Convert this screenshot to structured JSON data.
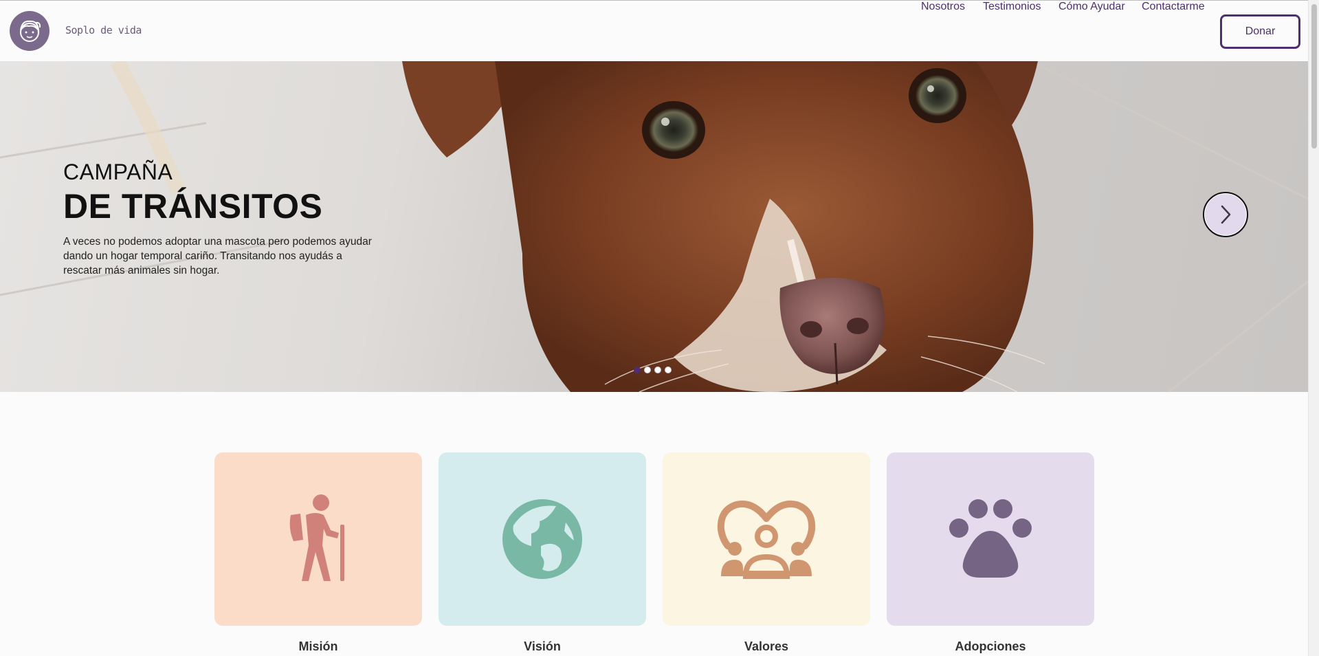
{
  "header": {
    "brand": "Soplo de vida",
    "nav": [
      "Nosotros",
      "Testimonios",
      "Cómo Ayudar",
      "Contactarme"
    ],
    "donate_label": "Donar"
  },
  "hero": {
    "kicker": "CAMPAÑA",
    "title": "DE TRÁNSITOS",
    "description": "A veces no podemos adoptar una mascota pero podemos ayudar dando un hogar temporal cariño. Transitando nos ayudás a rescatar más animales sin hogar.",
    "slides_total": 4,
    "active_slide": 1
  },
  "cards": [
    {
      "label": "Misión",
      "icon": "hiker-icon",
      "bg": "#fbdcc8",
      "fg": "#d0827a"
    },
    {
      "label": "Visión",
      "icon": "globe-icon",
      "bg": "#d5ecee",
      "fg": "#7ab8a6"
    },
    {
      "label": "Valores",
      "icon": "community-heart-icon",
      "bg": "#fcf5e1",
      "fg": "#d09670"
    },
    {
      "label": "Adopciones",
      "icon": "paw-icon",
      "bg": "#e4dbec",
      "fg": "#766485"
    }
  ],
  "colors": {
    "accent": "#4e2e6e",
    "logo_bg": "#7b6a8c"
  }
}
